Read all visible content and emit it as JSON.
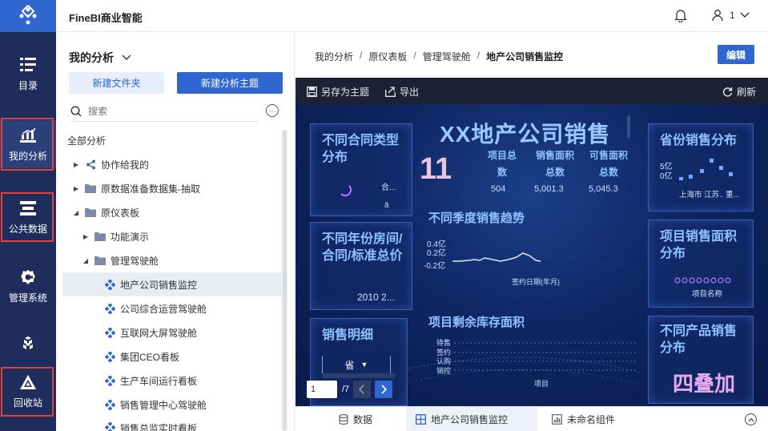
{
  "app": {
    "title": "FineBI商业智能"
  },
  "user": {
    "name": "1"
  },
  "nav": {
    "items": [
      {
        "label": "目录",
        "icon": "catalog-icon"
      },
      {
        "label": "我的分析",
        "icon": "analysis-icon"
      },
      {
        "label": "公共数据",
        "icon": "public-data-icon"
      },
      {
        "label": "管理系统",
        "icon": "gear-icon"
      },
      {
        "label": "",
        "icon": "cube-icon"
      },
      {
        "label": "回收站",
        "icon": "recycle-icon"
      }
    ]
  },
  "panel": {
    "title": "我的分析",
    "new_folder": "新建文件夹",
    "new_subject": "新建分析主题",
    "search_placeholder": "搜索",
    "root": "全部分析",
    "tree": [
      {
        "label": "协作给我的"
      },
      {
        "label": "原数据准备数据集-抽取"
      },
      {
        "label": "原仪表板"
      },
      {
        "label": "功能演示"
      },
      {
        "label": "管理驾驶舱"
      },
      {
        "label": "地产公司销售监控"
      },
      {
        "label": "公司综合运营驾驶舱"
      },
      {
        "label": "互联网大屏驾驶舱"
      },
      {
        "label": "集团CEO看板"
      },
      {
        "label": "生产车间运行看板"
      },
      {
        "label": "销售管理中心驾驶舱"
      },
      {
        "label": "销售总监实时看板"
      }
    ]
  },
  "breadcrumb": {
    "items": [
      "我的分析",
      "原仪表板",
      "管理驾驶舱",
      "地产公司销售监控"
    ],
    "separator": "/"
  },
  "edit_button": "编辑",
  "toolbar": {
    "save_as": "另存为主题",
    "export": "导出",
    "refresh": "刷新"
  },
  "dashboard": {
    "title": "XX地产公司销售",
    "big_number": "11",
    "kpis": [
      {
        "head": "项目总数",
        "value": "504"
      },
      {
        "head": "销售面积总数",
        "value": "5,001.3"
      },
      {
        "head": "可售面积总数",
        "value": "5,045.3"
      }
    ],
    "widgets": {
      "contract_type": {
        "title": "不同合同类型分布",
        "label1": "合...",
        "label2": "ä"
      },
      "year_house": {
        "title": "不同年份房间/合同/标准总价",
        "years": "2010   2..."
      },
      "detail": {
        "title": "销售明细",
        "column": "省"
      },
      "trend": {
        "title": "不同季度销售趋势",
        "y1": "0.4亿",
        "y2": "0.2亿",
        "y3": "-0.2亿",
        "xlabel": "签约日期(年月)"
      },
      "inventory": {
        "title": "项目剩余库存面积",
        "labels": [
          "待售",
          "签约",
          "认购",
          "销控"
        ],
        "xlabel": "项目"
      },
      "province": {
        "title": "省份销售分布",
        "y1": "5亿",
        "y2": "0亿",
        "xlabels": "上海市 江苏.. 重..."
      },
      "area": {
        "title": "项目销售面积分布",
        "xlabel": "项目名称"
      },
      "product": {
        "title": "不同产品销售分布",
        "overlay": "四叠加"
      }
    },
    "pager": {
      "current": "1",
      "total": "/7"
    }
  },
  "bottom_tabs": [
    {
      "label": "数据",
      "icon": "database-icon"
    },
    {
      "label": "地产公司销售监控",
      "icon": "dashboard-icon"
    },
    {
      "label": "未命名组件",
      "icon": "chart-icon"
    }
  ],
  "colors": {
    "primary": "#2f66d0",
    "nav_bg": "#1f2d5c",
    "highlight_red": "#e0413a",
    "dash_title": "#9bc9ff"
  }
}
